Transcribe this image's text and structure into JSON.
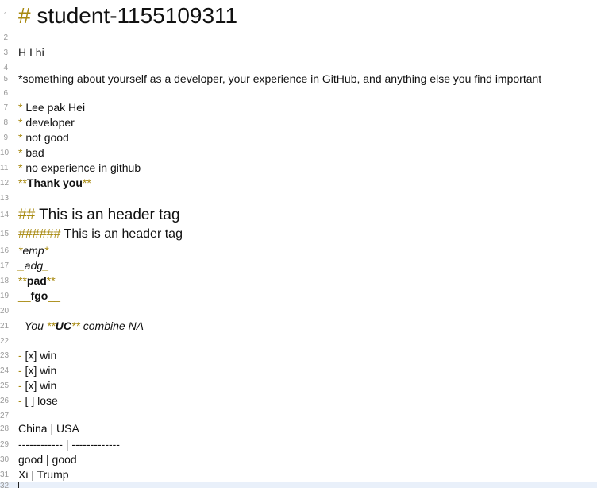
{
  "editor": {
    "lines": [
      {
        "num": "1",
        "parts": [
          {
            "t": "#",
            "c": "gold"
          },
          {
            "t": " student-1155109311"
          }
        ]
      },
      {
        "num": "2",
        "parts": []
      },
      {
        "num": "3",
        "parts": [
          {
            "t": "H I hi"
          }
        ]
      },
      {
        "num": "4",
        "parts": []
      },
      {
        "num": "5",
        "parts": [
          {
            "t": "*something about yourself as a developer, your experience in GitHub, and anything else you find important"
          }
        ]
      },
      {
        "num": "6",
        "parts": []
      },
      {
        "num": "7",
        "parts": [
          {
            "t": "*",
            "c": "gold"
          },
          {
            "t": " Lee pak Hei"
          }
        ]
      },
      {
        "num": "8",
        "parts": [
          {
            "t": "*",
            "c": "gold"
          },
          {
            "t": " developer"
          }
        ]
      },
      {
        "num": "9",
        "parts": [
          {
            "t": "*",
            "c": "gold"
          },
          {
            "t": " not good"
          }
        ]
      },
      {
        "num": "10",
        "parts": [
          {
            "t": "*",
            "c": "gold"
          },
          {
            "t": " bad"
          }
        ]
      },
      {
        "num": "11",
        "parts": [
          {
            "t": "*",
            "c": "gold"
          },
          {
            "t": " no experience in github"
          }
        ]
      },
      {
        "num": "12",
        "parts": [
          {
            "t": "**",
            "c": "gold"
          },
          {
            "t": "Thank you",
            "s": "strong"
          },
          {
            "t": "**",
            "c": "gold"
          }
        ]
      },
      {
        "num": "13",
        "parts": []
      },
      {
        "num": "14",
        "parts": [
          {
            "t": "##",
            "c": "gold"
          },
          {
            "t": " This is an header tag"
          }
        ]
      },
      {
        "num": "15",
        "parts": [
          {
            "t": "######",
            "c": "gold"
          },
          {
            "t": " This is an header tag"
          }
        ]
      },
      {
        "num": "16",
        "parts": [
          {
            "t": "*",
            "c": "gold"
          },
          {
            "t": "emp",
            "s": "em"
          },
          {
            "t": "*",
            "c": "gold"
          }
        ]
      },
      {
        "num": "17",
        "parts": [
          {
            "t": "_",
            "c": "gold"
          },
          {
            "t": "adg",
            "s": "em"
          },
          {
            "t": "_",
            "c": "gold"
          }
        ]
      },
      {
        "num": "18",
        "parts": [
          {
            "t": "**",
            "c": "gold"
          },
          {
            "t": "pad",
            "s": "strong"
          },
          {
            "t": "**",
            "c": "gold"
          }
        ]
      },
      {
        "num": "19",
        "parts": [
          {
            "t": "__",
            "c": "gold"
          },
          {
            "t": "fgo",
            "s": "strong"
          },
          {
            "t": "__",
            "c": "gold"
          }
        ]
      },
      {
        "num": "20",
        "parts": []
      },
      {
        "num": "21",
        "parts": [
          {
            "t": "_",
            "c": "gold"
          },
          {
            "t": "You ",
            "s": "em"
          },
          {
            "t": "**",
            "c": "gold"
          },
          {
            "t": "UC",
            "s": "emstrong"
          },
          {
            "t": "**",
            "c": "gold"
          },
          {
            "t": " combine NA",
            "s": "em"
          },
          {
            "t": "_",
            "c": "gold"
          }
        ]
      },
      {
        "num": "22",
        "parts": []
      },
      {
        "num": "23",
        "parts": [
          {
            "t": "-",
            "c": "gold"
          },
          {
            "t": " [x] win"
          }
        ]
      },
      {
        "num": "24",
        "parts": [
          {
            "t": "-",
            "c": "gold"
          },
          {
            "t": " [x] win"
          }
        ]
      },
      {
        "num": "25",
        "parts": [
          {
            "t": "-",
            "c": "gold"
          },
          {
            "t": " [x] win"
          }
        ]
      },
      {
        "num": "26",
        "parts": [
          {
            "t": "-",
            "c": "gold"
          },
          {
            "t": " [ ] lose"
          }
        ]
      },
      {
        "num": "27",
        "parts": []
      },
      {
        "num": "28",
        "parts": [
          {
            "t": "China | USA"
          }
        ]
      },
      {
        "num": "29",
        "parts": [
          {
            "t": "------------ | -------------"
          }
        ]
      },
      {
        "num": "30",
        "parts": [
          {
            "t": "good | good"
          }
        ]
      },
      {
        "num": "31",
        "parts": [
          {
            "t": "Xi | Trump"
          }
        ]
      },
      {
        "num": "32",
        "parts": []
      }
    ]
  }
}
